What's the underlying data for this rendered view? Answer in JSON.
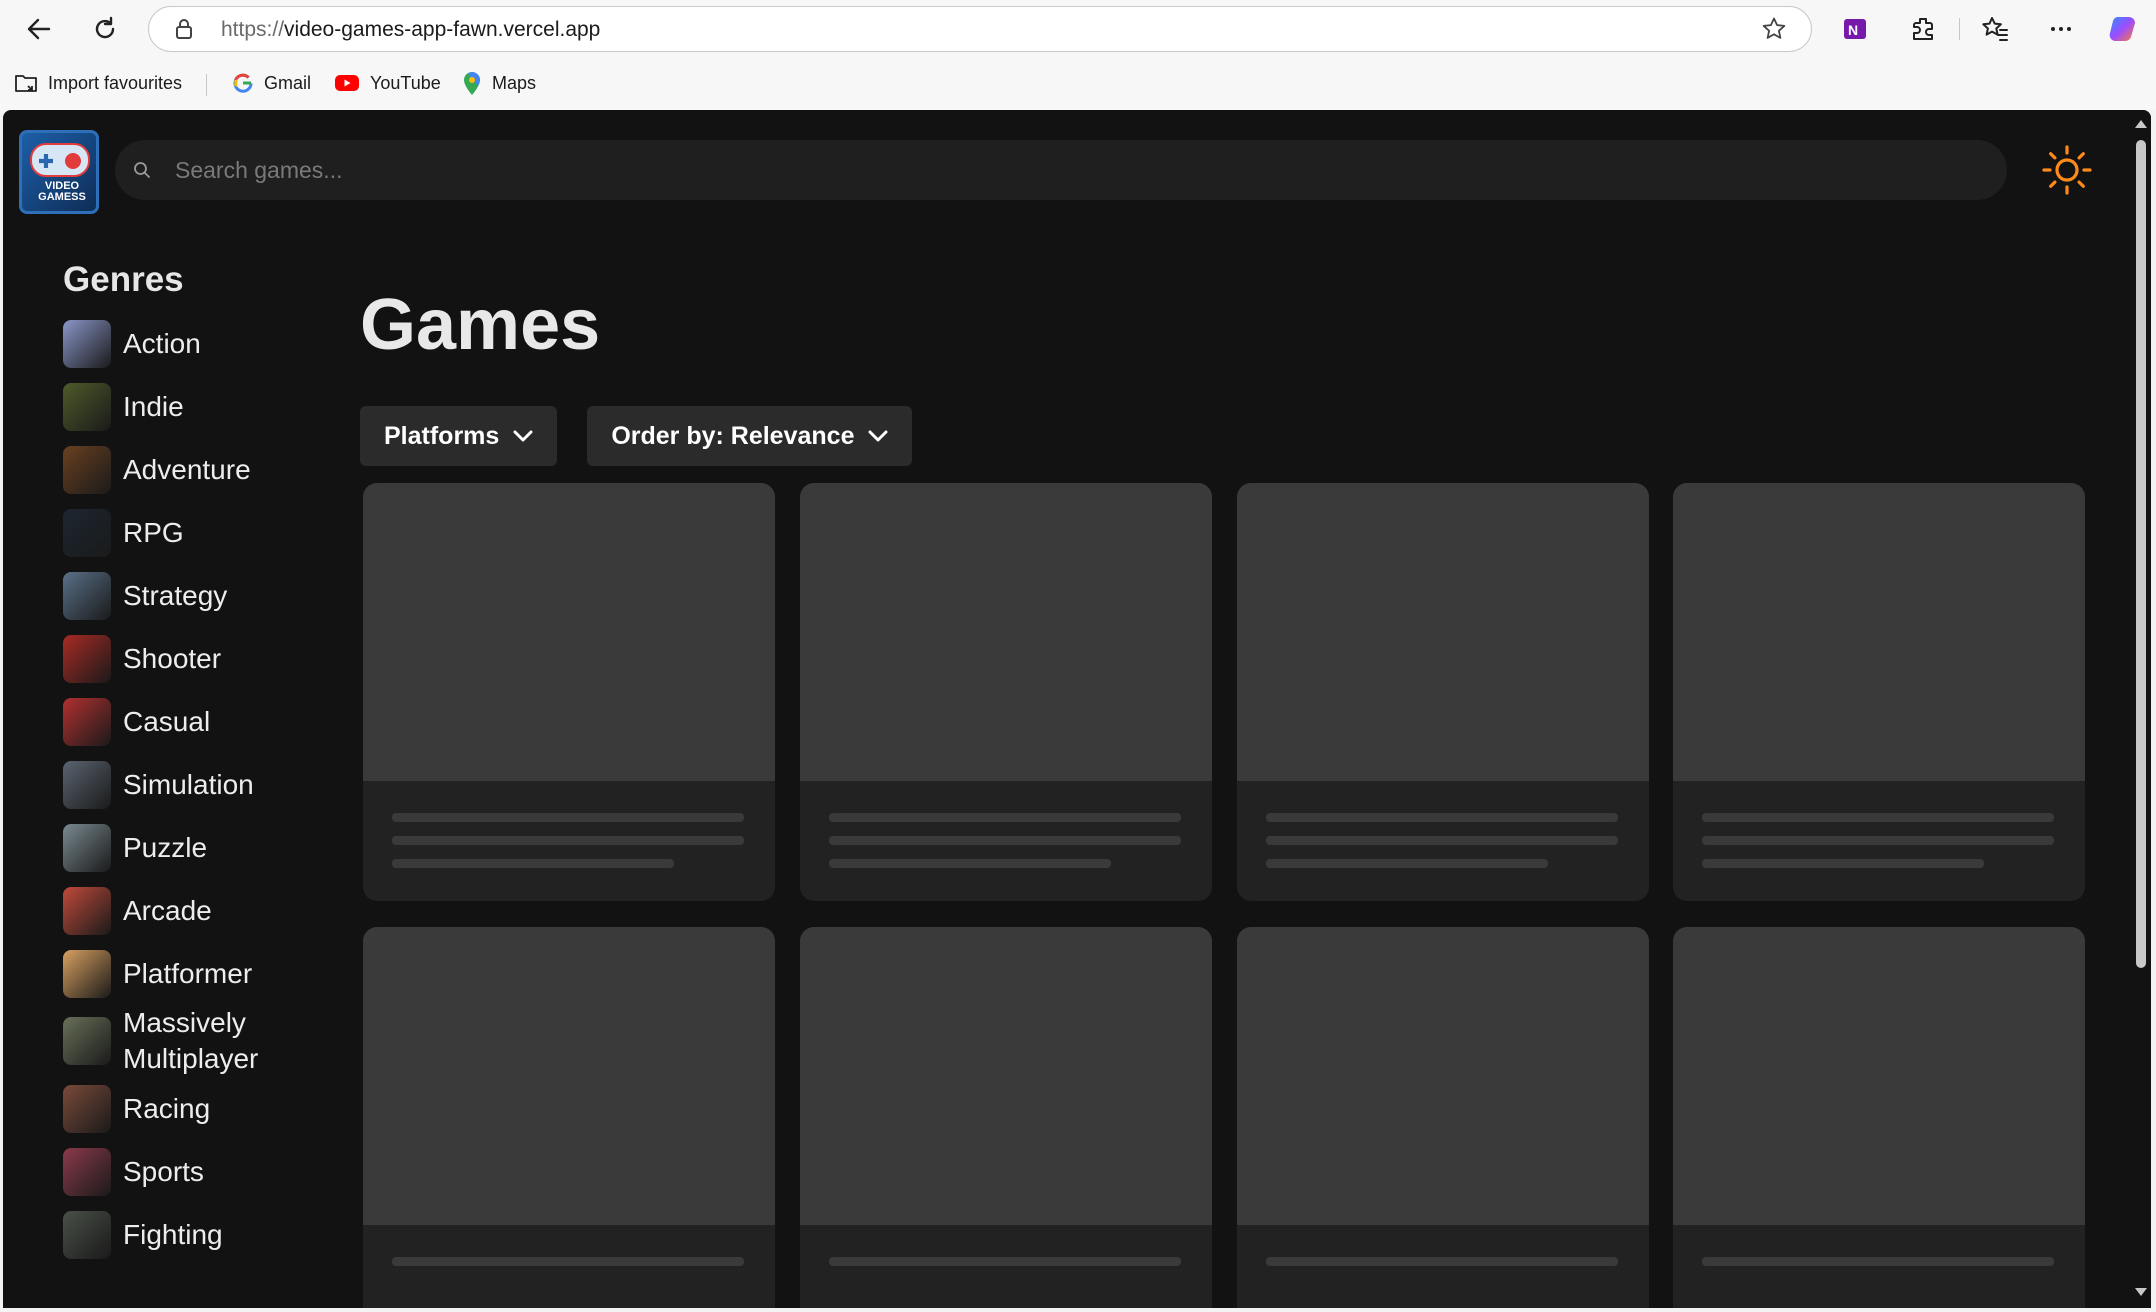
{
  "browser": {
    "url_scheme": "https://",
    "url_host": "video-games-app-fawn.vercel.app",
    "bookmarks": [
      {
        "label": "Import favourites",
        "icon": "import-folder-icon"
      },
      {
        "label": "Gmail",
        "icon": "google-icon"
      },
      {
        "label": "YouTube",
        "icon": "youtube-icon"
      },
      {
        "label": "Maps",
        "icon": "maps-pin-icon"
      }
    ]
  },
  "app": {
    "logo_text_1": "VIDEO",
    "logo_text_2": "GAMESS",
    "search_placeholder": "Search games...",
    "theme_icon": "sun-icon"
  },
  "sidebar": {
    "heading": "Genres",
    "genres": [
      {
        "label": "Action",
        "color": "#8a96c8"
      },
      {
        "label": "Indie",
        "color": "#4e5a2a"
      },
      {
        "label": "Adventure",
        "color": "#6a4020"
      },
      {
        "label": "RPG",
        "color": "#1c2630"
      },
      {
        "label": "Strategy",
        "color": "#5a7088"
      },
      {
        "label": "Shooter",
        "color": "#a82a24"
      },
      {
        "label": "Casual",
        "color": "#b23030"
      },
      {
        "label": "Simulation",
        "color": "#5a6470"
      },
      {
        "label": "Puzzle",
        "color": "#7a8a90"
      },
      {
        "label": "Arcade",
        "color": "#c04a3a"
      },
      {
        "label": "Platformer",
        "color": "#d8a060"
      },
      {
        "label": "Massively Multiplayer",
        "color": "#687058"
      },
      {
        "label": "Racing",
        "color": "#7a4a3a"
      },
      {
        "label": "Sports",
        "color": "#8a3a4a"
      },
      {
        "label": "Fighting",
        "color": "#4a5048"
      }
    ]
  },
  "main": {
    "title": "Games",
    "platforms_label": "Platforms",
    "order_label": "Order by: Relevance"
  }
}
